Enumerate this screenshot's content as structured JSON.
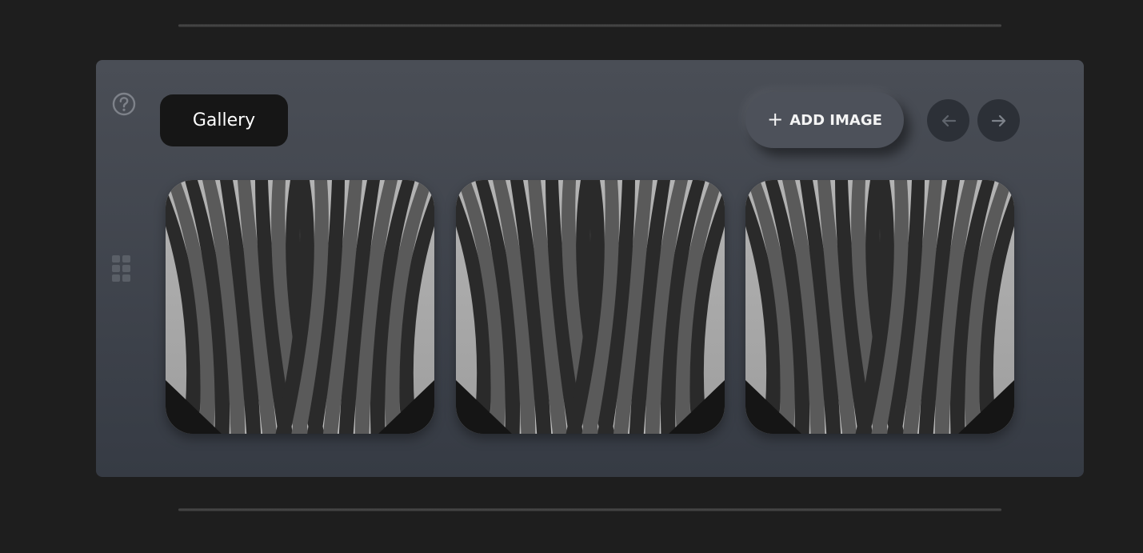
{
  "gallery": {
    "title": "Gallery",
    "add_button_label": "ADD IMAGE",
    "add_button_icon": "plus-icon",
    "images": [
      {
        "subject": "architecture-photo"
      },
      {
        "subject": "architecture-photo"
      },
      {
        "subject": "architecture-photo"
      }
    ]
  },
  "icons": {
    "help": "question-circle-icon",
    "grid": "grid-icon",
    "prev": "arrow-left-icon",
    "next": "arrow-right-icon"
  },
  "colors": {
    "page_background": "#1e1e1e",
    "panel_top": "#4a4e56",
    "panel_bottom": "#363b44",
    "title_pill": "#161616",
    "add_button": "#4d515a",
    "nav_button": "#2c3037"
  }
}
